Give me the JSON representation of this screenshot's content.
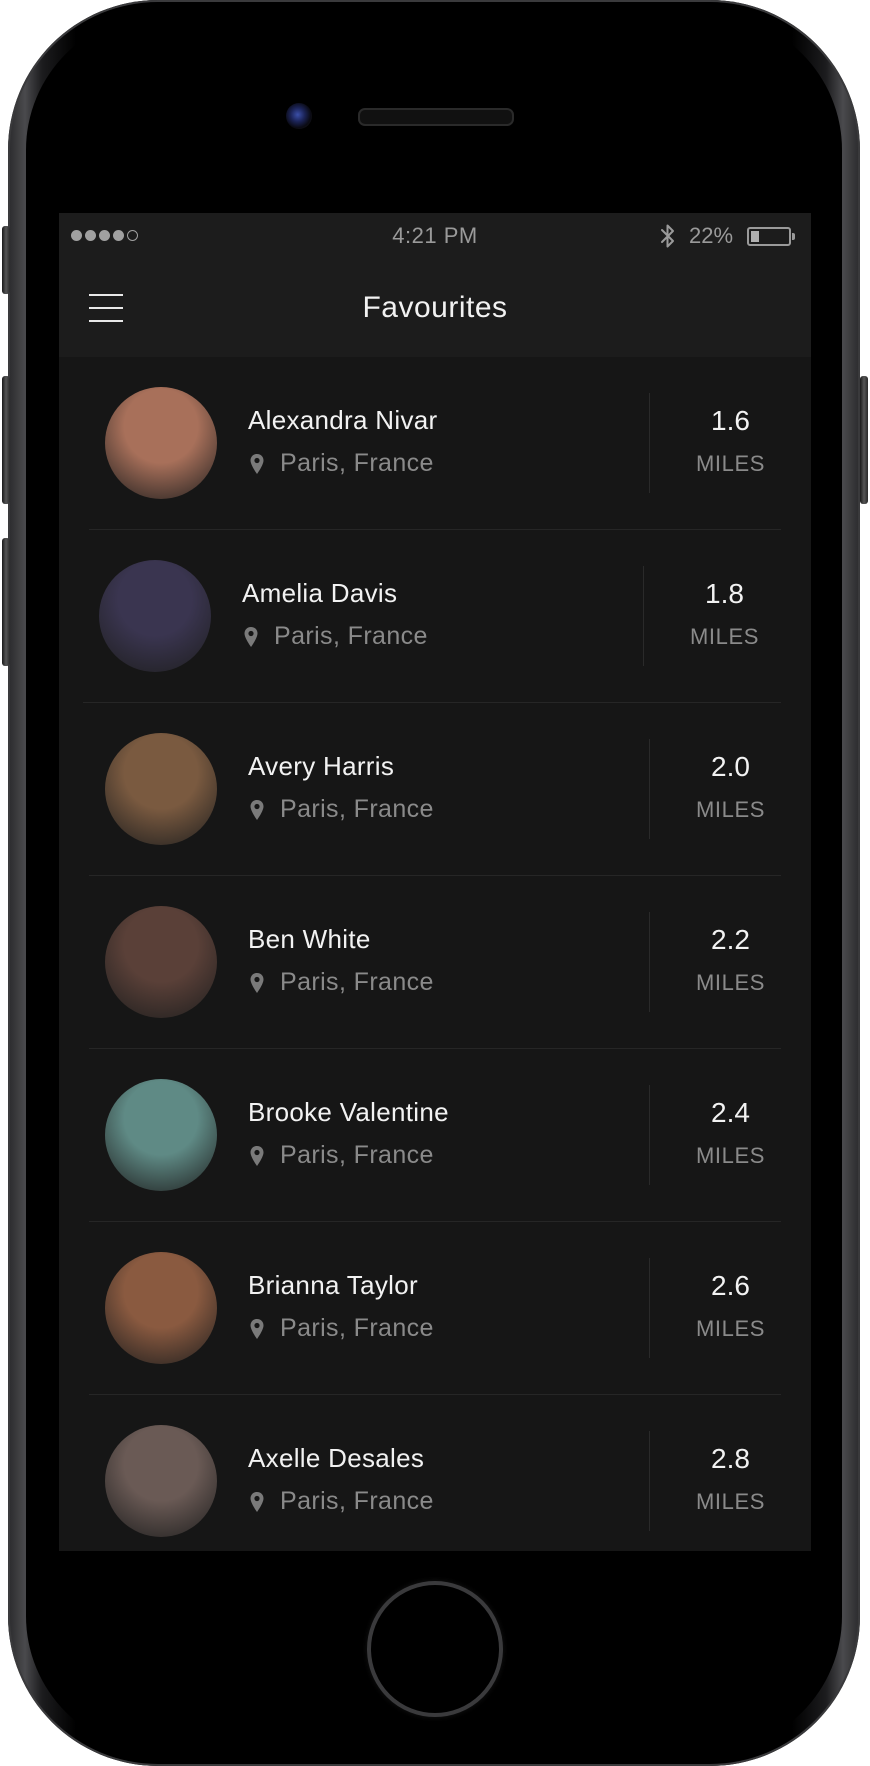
{
  "status_bar": {
    "time": "4:21 PM",
    "battery_percent": "22%",
    "battery_level": 0.22,
    "signal_bars_filled": 4,
    "signal_bars_total": 5
  },
  "nav": {
    "title": "Favourites",
    "menu_icon": "hamburger-menu-icon"
  },
  "favourites": [
    {
      "name": "Alexandra Nivar",
      "location": "Paris, France",
      "distance": "1.6",
      "unit": "MILES",
      "avatar_color": "#a8705a"
    },
    {
      "name": "Amelia Davis",
      "location": "Paris, France",
      "distance": "1.8",
      "unit": "MILES",
      "avatar_color": "#3a3550"
    },
    {
      "name": "Avery Harris",
      "location": "Paris, France",
      "distance": "2.0",
      "unit": "MILES",
      "avatar_color": "#7a5a40"
    },
    {
      "name": "Ben White",
      "location": "Paris, France",
      "distance": "2.2",
      "unit": "MILES",
      "avatar_color": "#5a4038"
    },
    {
      "name": "Brooke Valentine",
      "location": "Paris, France",
      "distance": "2.4",
      "unit": "MILES",
      "avatar_color": "#5f8a85"
    },
    {
      "name": "Brianna Taylor",
      "location": "Paris, France",
      "distance": "2.6",
      "unit": "MILES",
      "avatar_color": "#8a5a40"
    },
    {
      "name": "Axelle Desales",
      "location": "Paris, France",
      "distance": "2.8",
      "unit": "MILES",
      "avatar_color": "#6a5a55"
    }
  ],
  "colors": {
    "screen_bg": "#161616",
    "bar_bg": "#1c1c1c",
    "text_primary": "#f2f2f2",
    "text_secondary": "#8a8a8a"
  }
}
